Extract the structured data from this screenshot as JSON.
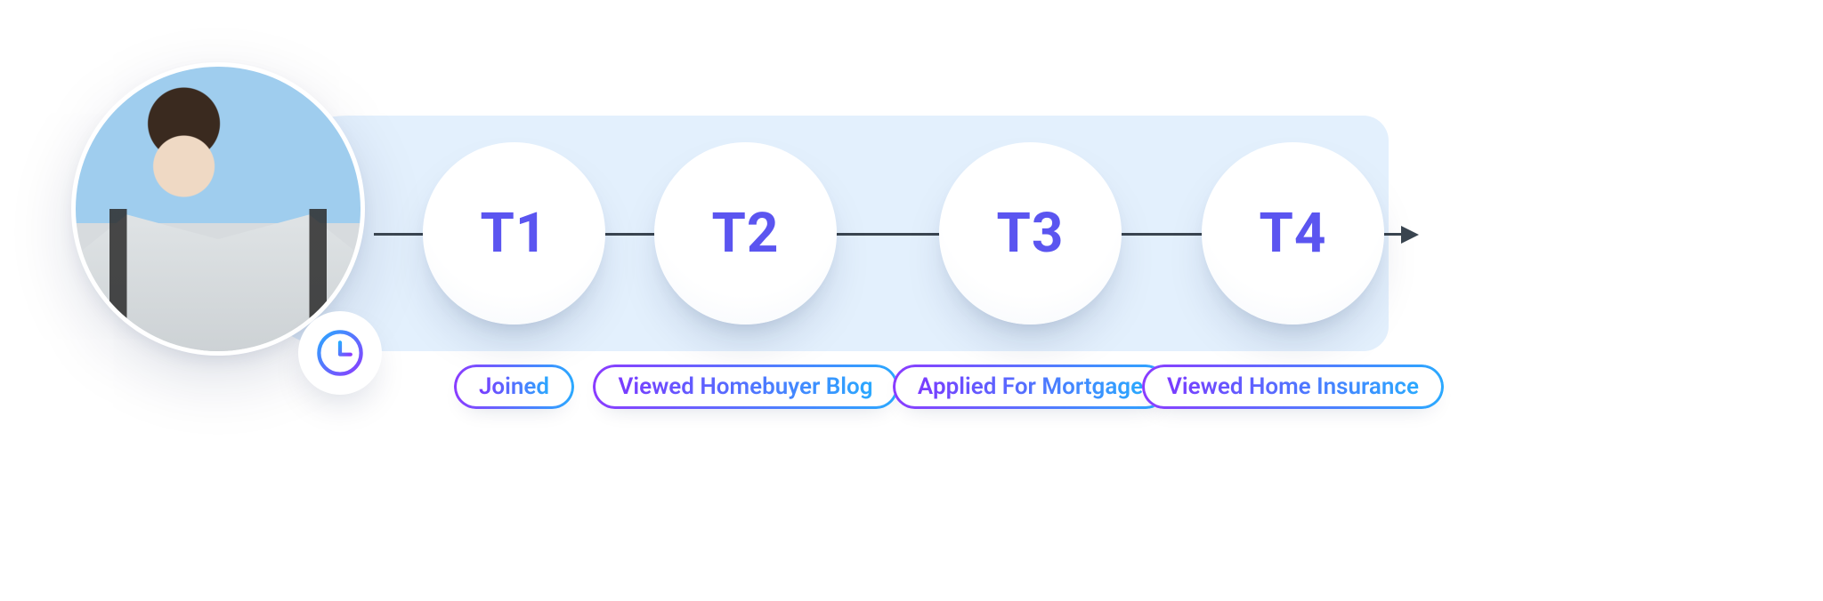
{
  "timeline": {
    "steps": [
      {
        "code": "T1",
        "label": "Joined"
      },
      {
        "code": "T2",
        "label": "Viewed Homebuyer Blog"
      },
      {
        "code": "T3",
        "label": "Applied For Mortgage"
      },
      {
        "code": "T4",
        "label": "Viewed Home Insurance"
      }
    ]
  },
  "icons": {
    "clock": "clock-icon"
  }
}
